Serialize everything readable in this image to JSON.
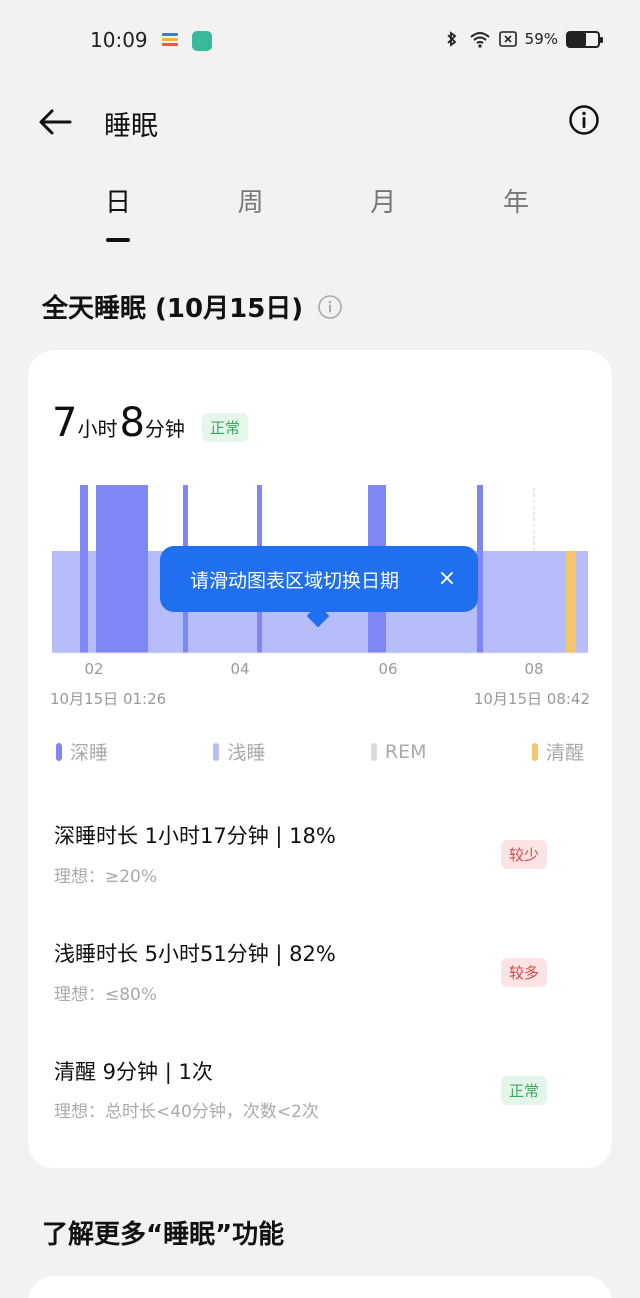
{
  "status_bar": {
    "time": "10:09",
    "battery_text": "59%",
    "battery_level": 0.59,
    "icons": [
      "bluetooth-icon",
      "wifi-icon",
      "sim-x-icon",
      "battery-icon"
    ]
  },
  "header": {
    "title": "睡眠",
    "back_icon": "arrow-left-icon",
    "info_icon": "info-icon"
  },
  "tabs": [
    {
      "label": "日",
      "active": true
    },
    {
      "label": "周",
      "active": false
    },
    {
      "label": "月",
      "active": false
    },
    {
      "label": "年",
      "active": false
    }
  ],
  "section": {
    "title": "全天睡眠 (10月15日)",
    "hint_icon": "info-outline-icon"
  },
  "summary": {
    "hours": "7",
    "hours_unit": "小时",
    "minutes": "8",
    "minutes_unit": "分钟",
    "status": "正常"
  },
  "chart": {
    "tooltip": "请滑动图表区域切换日期",
    "tooltip_close": "×",
    "ticks": [
      "02",
      "04",
      "06",
      "08"
    ],
    "start_label": "10月15日 01:26",
    "end_label": "10月15日 08:42",
    "colors": {
      "deep": "#7f86f5",
      "light": "#b7bcfa",
      "rem": "#dcdcdc",
      "awake": "#f6c46b"
    }
  },
  "legend": [
    {
      "label": "深睡",
      "color": "#7f86f5"
    },
    {
      "label": "浅睡",
      "color": "#b7bcfa"
    },
    {
      "label": "REM",
      "color": "#dcdcdc"
    },
    {
      "label": "清醒",
      "color": "#f6c46b"
    }
  ],
  "metrics": [
    {
      "title": "深睡时长  1小时17分钟 | 18%",
      "ideal": "理想：≥20%",
      "badge": "较少",
      "badge_type": "low"
    },
    {
      "title": "浅睡时长  5小时51分钟 | 82%",
      "ideal": "理想：≤80%",
      "badge": "较多",
      "badge_type": "low"
    },
    {
      "title": "清醒  9分钟 | 1次",
      "ideal": "理想：总时长<40分钟，次数<2次",
      "badge": "正常",
      "badge_type": "normal"
    }
  ],
  "more_section": {
    "title": "了解更多“睡眠”功能"
  }
}
